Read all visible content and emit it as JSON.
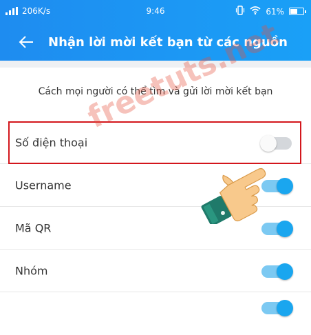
{
  "status_bar": {
    "speed": "206K/s",
    "time": "9:46",
    "battery": "61%",
    "battery_level": 0.61,
    "icons": [
      "signal-icon",
      "vibrate-icon",
      "wifi-icon",
      "battery-icon"
    ]
  },
  "header": {
    "title": "Nhận lời mời kết bạn từ các nguồn",
    "back_icon": "arrow-left-icon"
  },
  "description": "Cách mọi người có thể tìm và gửi lời mời kết bạn",
  "options": [
    {
      "label": "Số điện thoại",
      "enabled": false
    },
    {
      "label": "Username",
      "enabled": true
    },
    {
      "label": "Mã QR",
      "enabled": true
    },
    {
      "label": "Nhóm",
      "enabled": true
    },
    {
      "label": "",
      "enabled": true
    }
  ],
  "watermark": "freetuts.net",
  "colors": {
    "accent": "#1aa0f7",
    "toggle_on": "#1aa6ef",
    "highlight": "#d3161c"
  }
}
